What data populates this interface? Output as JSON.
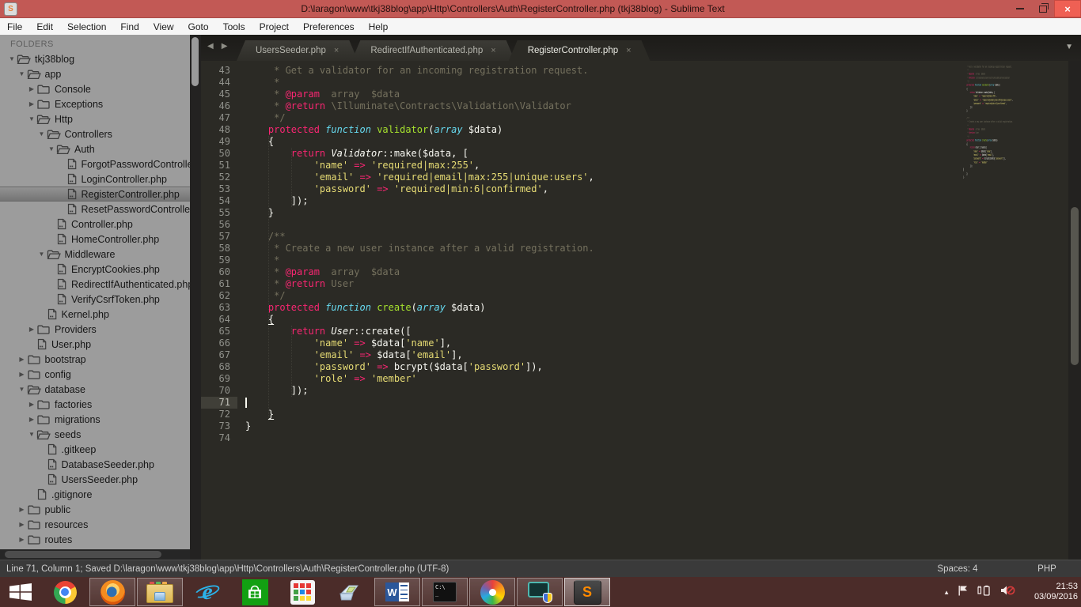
{
  "window": {
    "title": "D:\\laragon\\www\\tkj38blog\\app\\Http\\Controllers\\Auth\\RegisterController.php (tkj38blog) - Sublime Text",
    "app_icon": "S"
  },
  "menu": {
    "items": [
      "File",
      "Edit",
      "Selection",
      "Find",
      "View",
      "Goto",
      "Tools",
      "Project",
      "Preferences",
      "Help"
    ]
  },
  "sidebar": {
    "header": "FOLDERS",
    "items": [
      {
        "label": "tkj38blog",
        "level": 0,
        "kind": "folder",
        "expanded": true
      },
      {
        "label": "app",
        "level": 1,
        "kind": "folder",
        "expanded": true
      },
      {
        "label": "Console",
        "level": 2,
        "kind": "folder",
        "expanded": false
      },
      {
        "label": "Exceptions",
        "level": 2,
        "kind": "folder",
        "expanded": false
      },
      {
        "label": "Http",
        "level": 2,
        "kind": "folder",
        "expanded": true
      },
      {
        "label": "Controllers",
        "level": 3,
        "kind": "folder",
        "expanded": true
      },
      {
        "label": "Auth",
        "level": 4,
        "kind": "folder",
        "expanded": true
      },
      {
        "label": "ForgotPasswordController.php",
        "level": 5,
        "kind": "file-php"
      },
      {
        "label": "LoginController.php",
        "level": 5,
        "kind": "file-php"
      },
      {
        "label": "RegisterController.php",
        "level": 5,
        "kind": "file-php",
        "selected": true
      },
      {
        "label": "ResetPasswordController.php",
        "level": 5,
        "kind": "file-php"
      },
      {
        "label": "Controller.php",
        "level": 4,
        "kind": "file-php"
      },
      {
        "label": "HomeController.php",
        "level": 4,
        "kind": "file-php"
      },
      {
        "label": "Middleware",
        "level": 3,
        "kind": "folder",
        "expanded": true
      },
      {
        "label": "EncryptCookies.php",
        "level": 4,
        "kind": "file-php"
      },
      {
        "label": "RedirectIfAuthenticated.php",
        "level": 4,
        "kind": "file-php"
      },
      {
        "label": "VerifyCsrfToken.php",
        "level": 4,
        "kind": "file-php"
      },
      {
        "label": "Kernel.php",
        "level": 3,
        "kind": "file-php"
      },
      {
        "label": "Providers",
        "level": 2,
        "kind": "folder",
        "expanded": false
      },
      {
        "label": "User.php",
        "level": 2,
        "kind": "file-php"
      },
      {
        "label": "bootstrap",
        "level": 1,
        "kind": "folder",
        "expanded": false
      },
      {
        "label": "config",
        "level": 1,
        "kind": "folder",
        "expanded": false
      },
      {
        "label": "database",
        "level": 1,
        "kind": "folder",
        "expanded": true
      },
      {
        "label": "factories",
        "level": 2,
        "kind": "folder",
        "expanded": false
      },
      {
        "label": "migrations",
        "level": 2,
        "kind": "folder",
        "expanded": false
      },
      {
        "label": "seeds",
        "level": 2,
        "kind": "folder",
        "expanded": true
      },
      {
        "label": ".gitkeep",
        "level": 3,
        "kind": "file-plain"
      },
      {
        "label": "DatabaseSeeder.php",
        "level": 3,
        "kind": "file-php"
      },
      {
        "label": "UsersSeeder.php",
        "level": 3,
        "kind": "file-php"
      },
      {
        "label": ".gitignore",
        "level": 2,
        "kind": "file-plain"
      },
      {
        "label": "public",
        "level": 1,
        "kind": "folder",
        "expanded": false
      },
      {
        "label": "resources",
        "level": 1,
        "kind": "folder",
        "expanded": false
      },
      {
        "label": "routes",
        "level": 1,
        "kind": "folder",
        "expanded": false
      }
    ]
  },
  "tabs": [
    {
      "label": "UsersSeeder.php",
      "active": false,
      "close": "×"
    },
    {
      "label": "RedirectIfAuthenticated.php",
      "active": false,
      "close": "×"
    },
    {
      "label": "RegisterController.php",
      "active": true,
      "close": "×"
    }
  ],
  "tab_nav": {
    "back": "◀",
    "forward": "▶",
    "overflow": "▼"
  },
  "editor": {
    "first_line": 43,
    "cursor_line": 71,
    "lines": [
      [
        [
          "c",
          "     * Get a validator for an incoming registration request."
        ]
      ],
      [
        [
          "c",
          "     *"
        ]
      ],
      [
        [
          "c",
          "     * "
        ],
        [
          "k",
          "@param"
        ],
        [
          "c",
          "  array  $data"
        ]
      ],
      [
        [
          "c",
          "     * "
        ],
        [
          "k",
          "@return"
        ],
        [
          "c",
          " \\Illuminate\\Contracts\\Validation\\Validator"
        ]
      ],
      [
        [
          "c",
          "     */"
        ]
      ],
      [
        [
          "p",
          "    "
        ],
        [
          "k",
          "protected"
        ],
        [
          "p",
          " "
        ],
        [
          "t",
          "function"
        ],
        [
          "p",
          " "
        ],
        [
          "f",
          "validator"
        ],
        [
          "p",
          "("
        ],
        [
          "t",
          "array"
        ],
        [
          "p",
          " $data)"
        ]
      ],
      [
        [
          "p",
          "    {"
        ]
      ],
      [
        [
          "p",
          "        "
        ],
        [
          "k",
          "return"
        ],
        [
          "p",
          " "
        ],
        [
          "ci",
          "Validator"
        ],
        [
          "p",
          "::make($data, ["
        ]
      ],
      [
        [
          "p",
          "            "
        ],
        [
          "s",
          "'name'"
        ],
        [
          "p",
          " "
        ],
        [
          "k",
          "=>"
        ],
        [
          "p",
          " "
        ],
        [
          "s",
          "'required|max:255'"
        ],
        [
          "p",
          ","
        ]
      ],
      [
        [
          "p",
          "            "
        ],
        [
          "s",
          "'email'"
        ],
        [
          "p",
          " "
        ],
        [
          "k",
          "=>"
        ],
        [
          "p",
          " "
        ],
        [
          "s",
          "'required|email|max:255|unique:users'"
        ],
        [
          "p",
          ","
        ]
      ],
      [
        [
          "p",
          "            "
        ],
        [
          "s",
          "'password'"
        ],
        [
          "p",
          " "
        ],
        [
          "k",
          "=>"
        ],
        [
          "p",
          " "
        ],
        [
          "s",
          "'required|min:6|confirmed'"
        ],
        [
          "p",
          ","
        ]
      ],
      [
        [
          "p",
          "        ]);"
        ]
      ],
      [
        [
          "p",
          "    }"
        ]
      ],
      [],
      [
        [
          "c",
          "    /**"
        ]
      ],
      [
        [
          "c",
          "     * Create a new user instance after a valid registration."
        ]
      ],
      [
        [
          "c",
          "     *"
        ]
      ],
      [
        [
          "c",
          "     * "
        ],
        [
          "k",
          "@param"
        ],
        [
          "c",
          "  array  $data"
        ]
      ],
      [
        [
          "c",
          "     * "
        ],
        [
          "k",
          "@return"
        ],
        [
          "c",
          " User"
        ]
      ],
      [
        [
          "c",
          "     */"
        ]
      ],
      [
        [
          "p",
          "    "
        ],
        [
          "k",
          "protected"
        ],
        [
          "p",
          " "
        ],
        [
          "t",
          "function"
        ],
        [
          "p",
          " "
        ],
        [
          "f",
          "create"
        ],
        [
          "p",
          "("
        ],
        [
          "t",
          "array"
        ],
        [
          "p",
          " $data)"
        ]
      ],
      [
        [
          "p",
          "    "
        ],
        [
          "u",
          "{"
        ]
      ],
      [
        [
          "p",
          "        "
        ],
        [
          "k",
          "return"
        ],
        [
          "p",
          " "
        ],
        [
          "ci",
          "User"
        ],
        [
          "p",
          "::create(["
        ]
      ],
      [
        [
          "p",
          "            "
        ],
        [
          "s",
          "'name'"
        ],
        [
          "p",
          " "
        ],
        [
          "k",
          "=>"
        ],
        [
          "p",
          " $data["
        ],
        [
          "s",
          "'name'"
        ],
        [
          "p",
          "],"
        ]
      ],
      [
        [
          "p",
          "            "
        ],
        [
          "s",
          "'email'"
        ],
        [
          "p",
          " "
        ],
        [
          "k",
          "=>"
        ],
        [
          "p",
          " $data["
        ],
        [
          "s",
          "'email'"
        ],
        [
          "p",
          "],"
        ]
      ],
      [
        [
          "p",
          "            "
        ],
        [
          "s",
          "'password'"
        ],
        [
          "p",
          " "
        ],
        [
          "k",
          "=>"
        ],
        [
          "p",
          " bcrypt($data["
        ],
        [
          "s",
          "'password'"
        ],
        [
          "p",
          "]),"
        ]
      ],
      [
        [
          "p",
          "            "
        ],
        [
          "s",
          "'role'"
        ],
        [
          "p",
          " "
        ],
        [
          "k",
          "=>"
        ],
        [
          "p",
          " "
        ],
        [
          "s",
          "'member'"
        ]
      ],
      [
        [
          "p",
          "        ]);"
        ]
      ],
      [],
      [
        [
          "p",
          "    "
        ],
        [
          "u",
          "}"
        ]
      ],
      [
        [
          "p",
          "}"
        ]
      ],
      []
    ]
  },
  "status_bar": {
    "left": "Line 71, Column 1; Saved D:\\laragon\\www\\tkj38blog\\app\\Http\\Controllers\\Auth\\RegisterController.php (UTF-8)",
    "spaces": "Spaces: 4",
    "syntax": "PHP"
  },
  "taskbar": {
    "apps": [
      {
        "name": "start",
        "running": false,
        "active": false
      },
      {
        "name": "chrome",
        "running": false,
        "active": false
      },
      {
        "name": "firefox",
        "running": true,
        "active": false
      },
      {
        "name": "file-explorer",
        "running": true,
        "active": false
      },
      {
        "name": "internet-explorer",
        "running": false,
        "active": false
      },
      {
        "name": "windows-store",
        "running": false,
        "active": false
      },
      {
        "name": "app-grid",
        "running": false,
        "active": false
      },
      {
        "name": "scanner-app",
        "running": false,
        "active": false
      },
      {
        "name": "word",
        "running": true,
        "active": false
      },
      {
        "name": "command-prompt",
        "running": true,
        "active": false
      },
      {
        "name": "photoscape",
        "running": true,
        "active": false
      },
      {
        "name": "remote-viewer",
        "running": true,
        "active": false
      },
      {
        "name": "sublime-text",
        "running": true,
        "active": true
      }
    ],
    "tray": {
      "hidden_icons": "▲",
      "time": "21:53",
      "date": "03/09/2016"
    }
  },
  "colors": {
    "titlebar": "#c25955",
    "close_button": "#ef6054",
    "menubar": "#f6f6f6",
    "editor_bg": "#2b2a25",
    "sidebar_bg": "#9c9c9c",
    "taskbar": "#4b2c29",
    "statusbar": "#3a3a3a",
    "syntax_comment": "#75715e",
    "syntax_keyword": "#f92672",
    "syntax_type": "#66d9ef",
    "syntax_function": "#a6e22e",
    "syntax_string": "#e6db74",
    "syntax_plain": "#f8f8f2",
    "gutter_text": "#90918b"
  }
}
